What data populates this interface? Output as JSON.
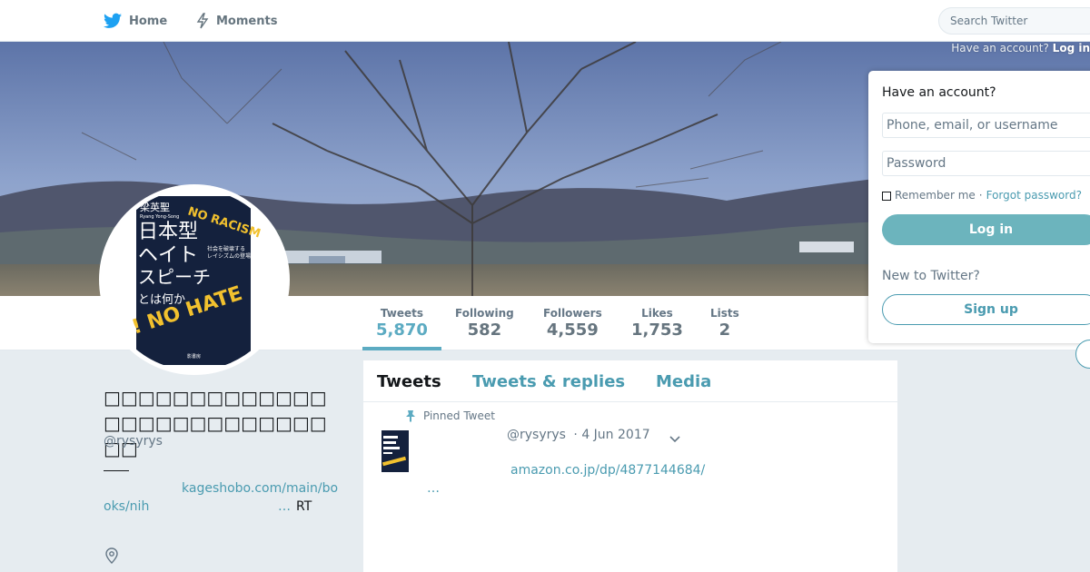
{
  "topbar": {
    "home_label": "Home",
    "moments_label": "Moments",
    "search_placeholder": "Search Twitter"
  },
  "header_login_hint": {
    "text": "Have an account?",
    "link": "Log in"
  },
  "profile": {
    "avatar_lines": {
      "author": "梁英聖",
      "author_romaji": "Ryang Yong-Song",
      "title_1": "日本型",
      "title_2": "ヘイト",
      "title_3": "スピーチ",
      "title_4": "とは何か",
      "subtitle_1": "社会を破壊する",
      "subtitle_2": "レイシズムの登場",
      "slogan_1": "NO RACISM",
      "slogan_2": "! NO HATE",
      "publisher": "影書房"
    },
    "display_name": "□□□□□□□□□□□□□□□□□□□□□□□□□□□□",
    "handle": "@rysyrys",
    "bio_link_1": "kageshobo.com/main/bo",
    "bio_link_2": "oks/nih",
    "bio_ellipsis": "…",
    "bio_rt": "RT"
  },
  "stats": [
    {
      "label": "Tweets",
      "value": "5,870"
    },
    {
      "label": "Following",
      "value": "582"
    },
    {
      "label": "Followers",
      "value": "4,559"
    },
    {
      "label": "Likes",
      "value": "1,753"
    },
    {
      "label": "Lists",
      "value": "2"
    }
  ],
  "timeline": {
    "tabs": [
      "Tweets",
      "Tweets & replies",
      "Media"
    ],
    "pinned_label": "Pinned Tweet",
    "tweet_handle": "@rysyrys",
    "tweet_date": "· 4 Jun 2017",
    "tweet_link": "amazon.co.jp/dp/4877144684/",
    "tweet_ellipsis": "…"
  },
  "login": {
    "title": "Have an account?",
    "username_placeholder": "Phone, email, or username",
    "password_placeholder": "Password",
    "remember_label": "Remember me",
    "separator": "·",
    "forgot_label": "Forgot password?",
    "login_button": "Log in",
    "new_to": "New to Twitter?",
    "signup_button": "Sign up"
  },
  "colors": {
    "accent": "#4a9bb0",
    "login_button": "#6cb4bd",
    "book_cover": "#14213d",
    "book_slogan": "#f2c12e"
  },
  "icons": {
    "home": "twitter-bird-icon",
    "moments": "lightning-icon",
    "pinned": "pin-icon",
    "caret": "chevron-down-icon",
    "location": "location-pin-icon"
  }
}
